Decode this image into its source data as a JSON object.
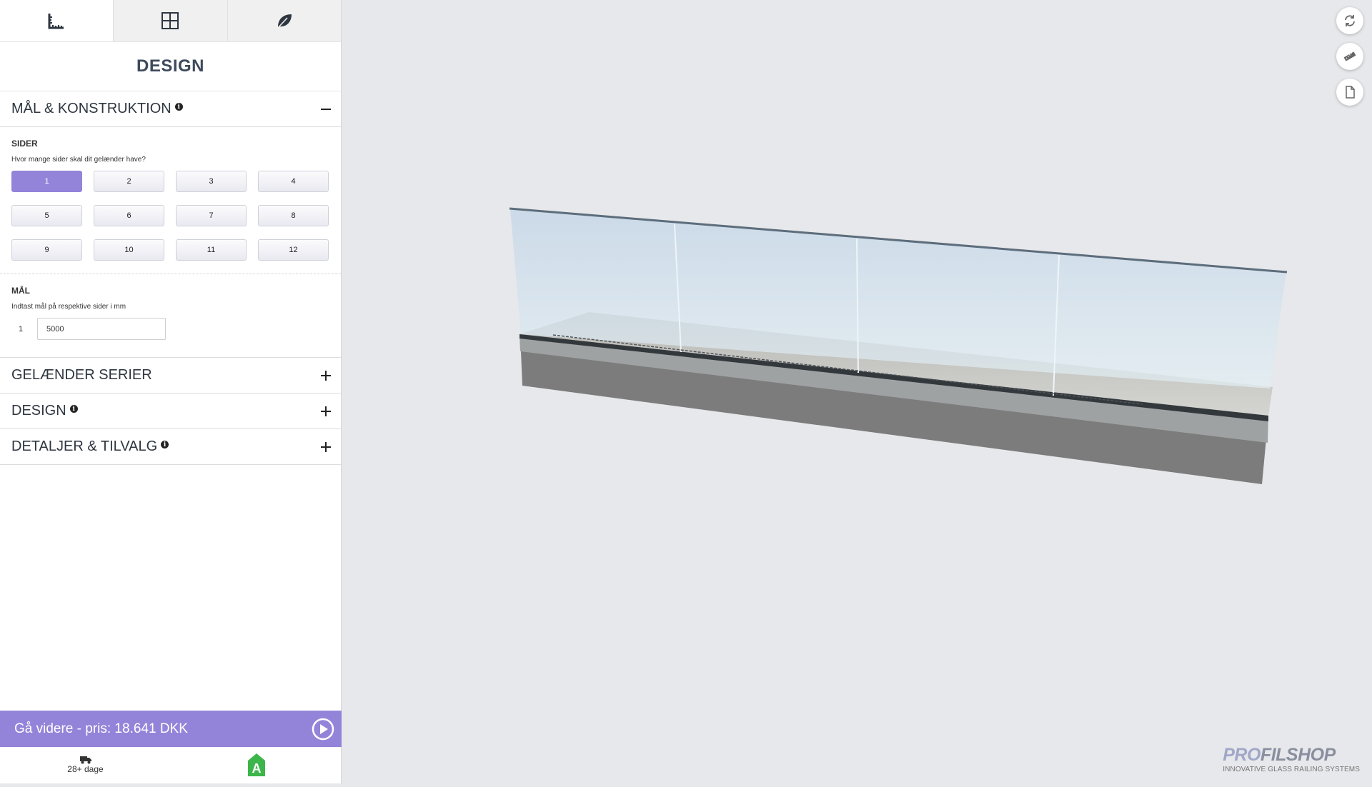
{
  "sidebar": {
    "tabs": [
      {
        "icon": "ruler-icon"
      },
      {
        "icon": "window-grid-icon"
      },
      {
        "icon": "leaf-icon"
      }
    ],
    "title": "DESIGN",
    "accordion": {
      "maal_konstruktion": {
        "label": "MÅL & KONSTRUKTION",
        "sider": {
          "title": "SIDER",
          "hint": "Hvor mange sider skal dit gelænder have?",
          "options": [
            "1",
            "2",
            "3",
            "4",
            "5",
            "6",
            "7",
            "8",
            "9",
            "10",
            "11",
            "12"
          ],
          "selected": "1"
        },
        "maal": {
          "title": "MÅL",
          "hint": "Indtast mål på respektive sider i mm",
          "rows": [
            {
              "index": "1",
              "value": "5000"
            }
          ]
        }
      },
      "gelaender_serier": {
        "label": "GELÆNDER SERIER"
      },
      "design": {
        "label": "DESIGN"
      },
      "detaljer": {
        "label": "DETALJER & TILVALG"
      }
    },
    "cta": {
      "label": "Gå videre - pris: 18.641 DKK"
    },
    "footer": {
      "delivery": "28+ dage",
      "energy_label": "A"
    }
  },
  "viewport": {
    "buttons": [
      "refresh-icon",
      "measure-tape-icon",
      "document-icon"
    ],
    "logo": {
      "pro": "PRO",
      "name": "FILSHOP",
      "tagline": "INNOVATIVE GLASS RAILING SYSTEMS"
    }
  },
  "colors": {
    "accent": "#9484d9",
    "energy_green": "#3cb54a",
    "background": "#e7e8eb"
  }
}
